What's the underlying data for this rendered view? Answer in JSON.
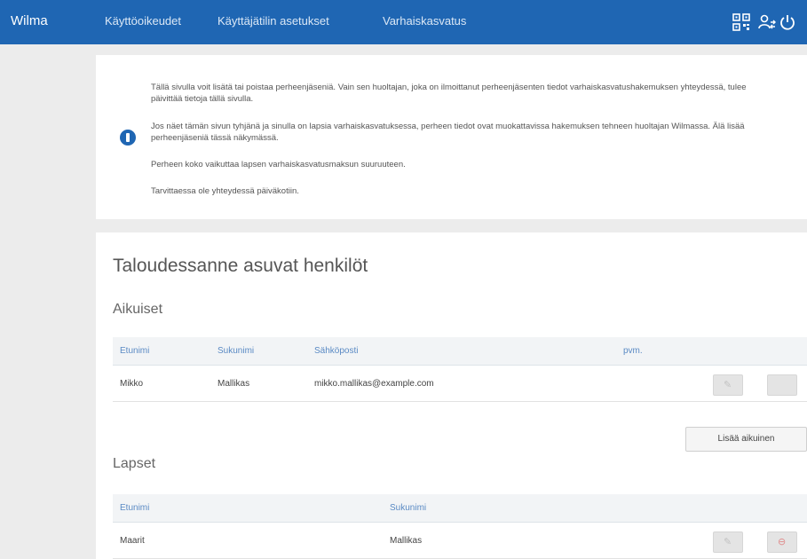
{
  "header": {
    "app_title": "Wilma",
    "nav": [
      "Käyttöoikeudet",
      "Käyttäjätilin asetukset",
      "Varhaiskasvatus"
    ],
    "icons": [
      "qr-code-icon",
      "user-switch-icon",
      "power-icon"
    ]
  },
  "info": {
    "paragraphs": [
      "Tällä sivulla voit lisätä tai poistaa perheenjäseniä. Vain sen huoltajan, joka on ilmoittanut perheenjäsenten tiedot varhaiskasvatushakemuksen yhteydessä, tulee päivittää tietoja tällä sivulla.",
      "Jos näet tämän sivun tyhjänä ja sinulla on lapsia varhaiskasvatuksessa, perheen tiedot ovat muokattavissa hakemuksen tehneen huoltajan Wilmassa. Älä lisää perheenjäseniä tässä näkymässä.",
      "Perheen koko vaikuttaa lapsen varhaiskasvatusmaksun suuruuteen.",
      "Tarvittaessa ole yhteydessä päiväkotiin."
    ]
  },
  "household": {
    "title": "Taloudessanne asuvat henkilöt",
    "adults": {
      "heading": "Aikuiset",
      "columns": [
        "Etunimi",
        "Sukunimi",
        "Sähköposti",
        "pvm."
      ],
      "rows": [
        {
          "first": "Mikko",
          "last": "Mallikas",
          "email": "mikko.mallikas@example.com",
          "date": ""
        }
      ],
      "add_label": "Lisää aikuinen"
    },
    "children": {
      "heading": "Lapset",
      "columns": [
        "Etunimi",
        "Sukunimi"
      ],
      "rows": [
        {
          "first": "Maarit",
          "last": "Mallikas"
        }
      ]
    }
  },
  "colors": {
    "brand": "#1f66b3",
    "link": "#5a8ac4",
    "delete": "#e08a8a"
  }
}
